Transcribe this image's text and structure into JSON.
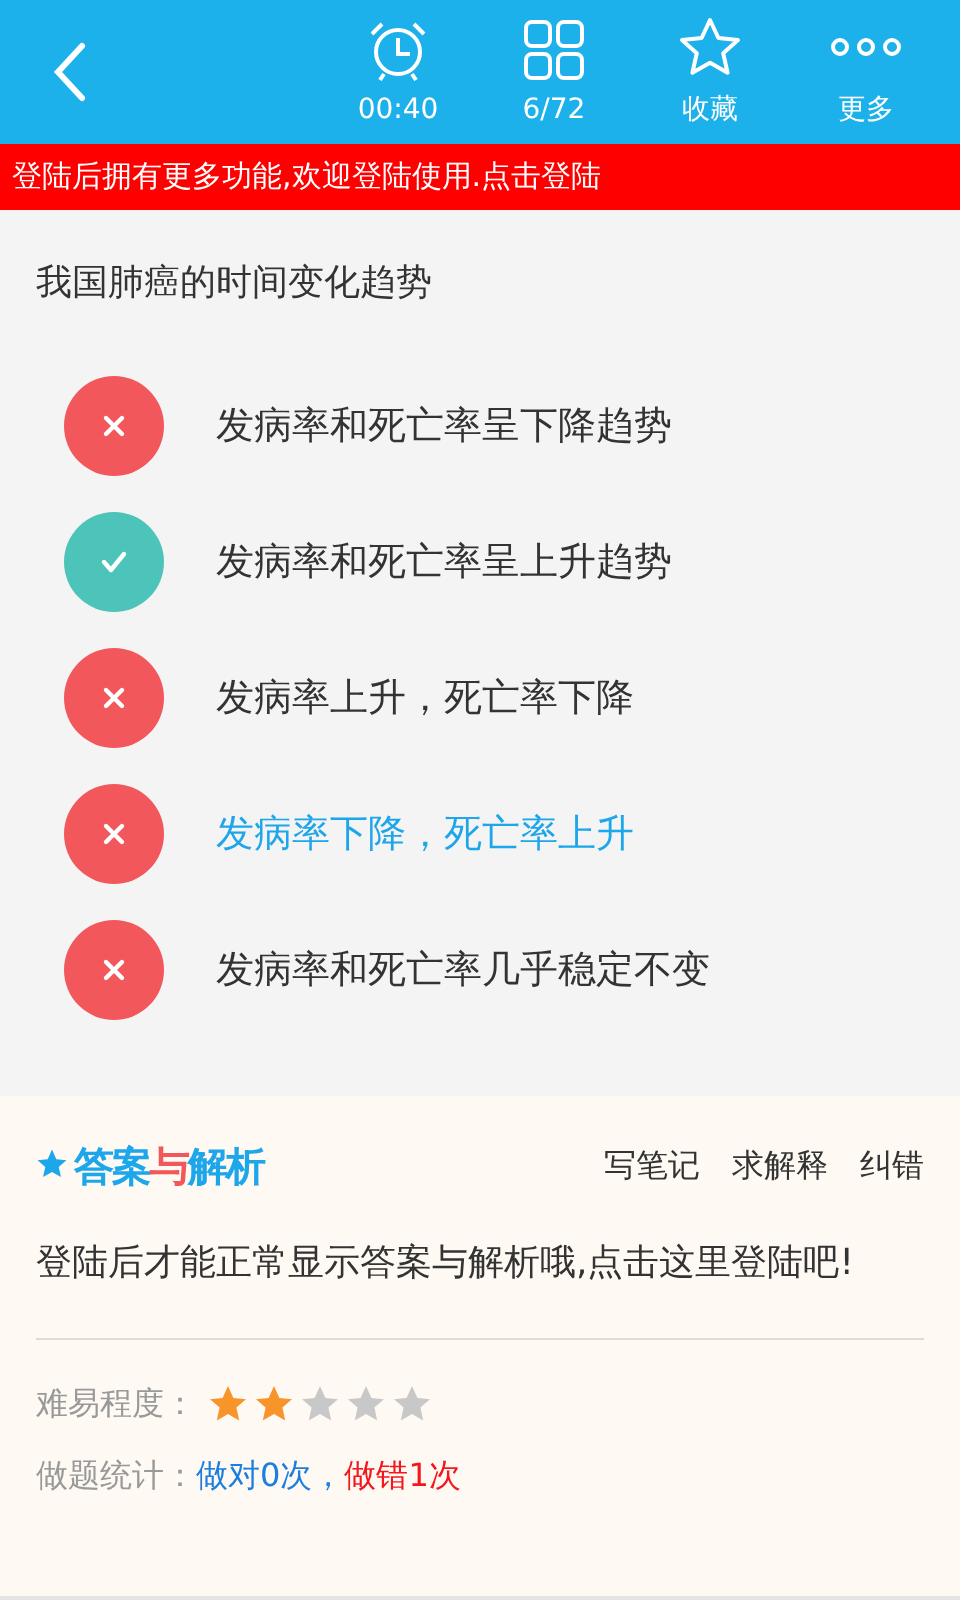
{
  "toolbar": {
    "items": [
      {
        "kind": "timer",
        "label": "00:40"
      },
      {
        "kind": "grid",
        "label": "6/72"
      },
      {
        "kind": "favorite",
        "label": "收藏"
      },
      {
        "kind": "more",
        "label": "更多"
      }
    ]
  },
  "banner": "登陆后拥有更多功能,欢迎登陆使用.点击登陆",
  "question": "我国肺癌的时间变化趋势",
  "options": [
    {
      "text": "发病率和死亡率呈下降趋势",
      "correct": false,
      "selected": false
    },
    {
      "text": "发病率和死亡率呈上升趋势",
      "correct": true,
      "selected": false
    },
    {
      "text": "发病率上升，死亡率下降",
      "correct": false,
      "selected": false
    },
    {
      "text": "发病率下降，死亡率上升",
      "correct": false,
      "selected": true
    },
    {
      "text": "发病率和死亡率几乎稳定不变",
      "correct": false,
      "selected": false
    }
  ],
  "answer": {
    "logo": [
      "答案",
      "与",
      "解析"
    ],
    "actions": [
      "写笔记",
      "求解释",
      "纠错"
    ],
    "message": "登陆后才能正常显示答案与解析哦,点击这里登陆吧!",
    "difficulty_label": "难易程度：",
    "stars": 2,
    "stats_label": "做题统计：",
    "stats_correct": "做对0次",
    "stats_separator": "，",
    "stats_wrong": "做错1次"
  }
}
